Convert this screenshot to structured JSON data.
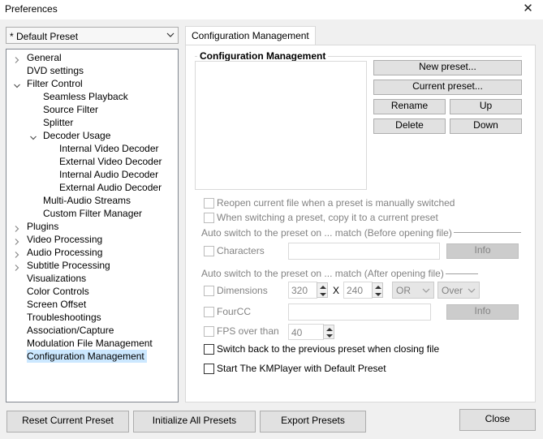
{
  "window": {
    "title": "Preferences",
    "close_glyph": "✕"
  },
  "preset_select": {
    "value": "* Default Preset"
  },
  "tree": {
    "items": [
      "General",
      "DVD settings",
      "Filter Control",
      "Seamless Playback",
      "Source Filter",
      "Splitter",
      "Decoder Usage",
      "Internal Video Decoder",
      "External Video Decoder",
      "Internal Audio Decoder",
      "External Audio Decoder",
      "Multi-Audio Streams",
      "Custom Filter Manager",
      "Plugins",
      "Video Processing",
      "Audio Processing",
      "Subtitle Processing",
      "Visualizations",
      "Color Controls",
      "Screen Offset",
      "Troubleshootings",
      "Association/Capture",
      "Modulation File Management",
      "Configuration Management"
    ],
    "selected": "Configuration Management"
  },
  "tab": {
    "label": "Configuration Management"
  },
  "config": {
    "group_title": "Configuration Management",
    "buttons": {
      "new_preset": "New preset...",
      "current_preset": "Current preset...",
      "rename": "Rename",
      "up": "Up",
      "delete": "Delete",
      "down": "Down"
    },
    "reopen_label": "Reopen current file when a preset is manually switched",
    "copy_label": "When switching a preset, copy it to a current preset",
    "before_section": "Auto switch to the preset on ... match (Before opening file)",
    "characters_label": "Characters",
    "info_label": "Info",
    "after_section": "Auto switch to the preset on ... match (After opening file)",
    "dimensions_label": "Dimensions",
    "width_value": "320",
    "x_label": "X",
    "height_value": "240",
    "logic_select": "OR",
    "compare_select": "Over",
    "fourcc_label": "FourCC",
    "fps_label": "FPS over than",
    "fps_value": "40",
    "switch_back_label": "Switch back to the previous preset when closing file",
    "start_default_label": "Start The KMPlayer with Default Preset"
  },
  "footer": {
    "reset_label": "Reset Current Preset",
    "initialize_label": "Initialize All Presets",
    "export_label": "Export Presets",
    "close_label": "Close"
  }
}
